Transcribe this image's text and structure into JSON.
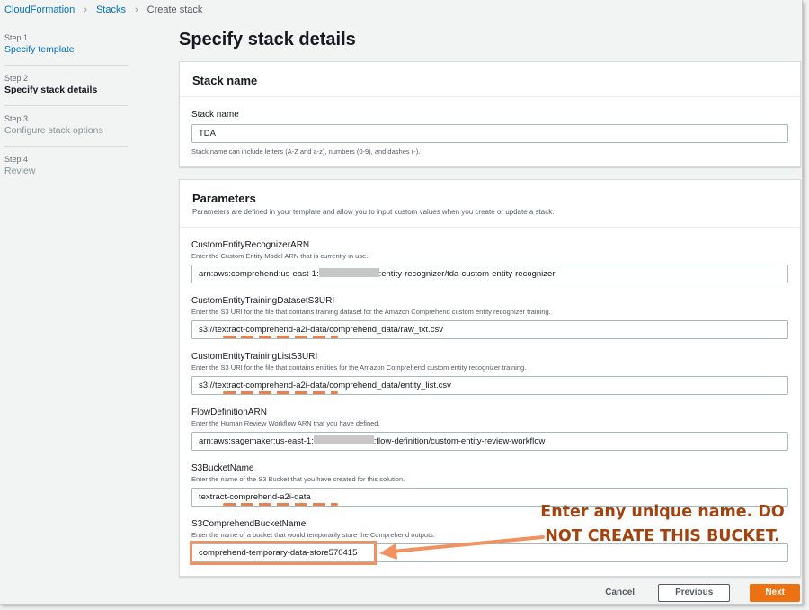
{
  "breadcrumb": {
    "items": [
      "CloudFormation",
      "Stacks",
      "Create stack"
    ]
  },
  "steps": [
    {
      "num": "Step 1",
      "label": "Specify template"
    },
    {
      "num": "Step 2",
      "label": "Specify stack details"
    },
    {
      "num": "Step 3",
      "label": "Configure stack options"
    },
    {
      "num": "Step 4",
      "label": "Review"
    }
  ],
  "page_title": "Specify stack details",
  "stack_name_section": {
    "heading": "Stack name",
    "field_label": "Stack name",
    "value": "TDA",
    "hint": "Stack name can include letters (A-Z and a-z), numbers (0-9), and dashes (-)."
  },
  "parameters_section": {
    "heading": "Parameters",
    "description": "Parameters are defined in your template and allow you to input custom values when you create or update a stack.",
    "fields": [
      {
        "label": "CustomEntityRecognizerARN",
        "description": "Enter the Custom Entity Model ARN that is currently in use.",
        "value_prefix": "arn:aws:comprehend:us-east-1:",
        "value_suffix": ":entity-recognizer/tda-custom-entity-recognizer"
      },
      {
        "label": "CustomEntityTrainingDatasetS3URI",
        "description": "Enter the S3 URI for the file that contains training dataset for the Amazon Comprehend custom entity recognizer training.",
        "value": "s3://textract-comprehend-a2i-data/comprehend_data/raw_txt.csv"
      },
      {
        "label": "CustomEntityTrainingListS3URI",
        "description": "Enter the S3 URI for the file that contains entities for the Amazon Comprehend custom entity recognizer training.",
        "value": "s3://textract-comprehend-a2i-data/comprehend_data/entity_list.csv"
      },
      {
        "label": "FlowDefinitionARN",
        "description": "Enter the Human Review Workflow ARN that you have defined.",
        "value_prefix": "arn:aws:sagemaker:us-east-1:",
        "value_suffix": ":flow-definition/custom-entity-review-workflow"
      },
      {
        "label": "S3BucketName",
        "description": "Enter the name of the S3 Bucket that you have created for this solution.",
        "value": "textract-comprehend-a2i-data"
      },
      {
        "label": "S3ComprehendBucketName",
        "description": "Enter the name of a bucket that would temporarily store the Comprehend outputs.",
        "value": "comprehend-temporary-data-store570415"
      }
    ]
  },
  "annotation": {
    "line1": "Enter any unique name. DO",
    "line2": "NOT CREATE THIS BUCKET.",
    "color": "#a2420f"
  },
  "actions": {
    "cancel": "Cancel",
    "previous": "Previous",
    "next": "Next"
  },
  "colors": {
    "link": "#0073bb",
    "primary_button": "#ec7211",
    "annotation_orange": "#f0915f"
  }
}
